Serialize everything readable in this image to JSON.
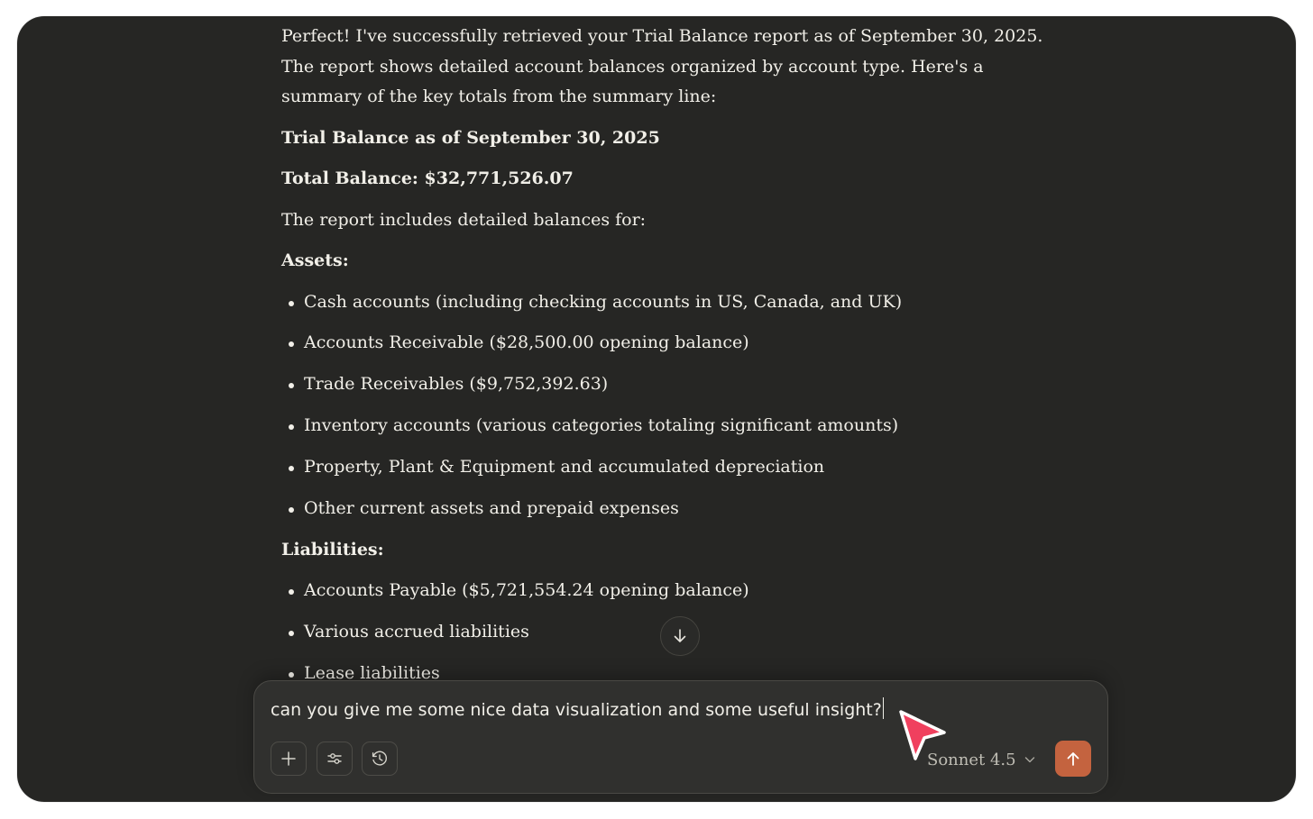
{
  "message": {
    "intro": "Perfect! I've successfully retrieved your Trial Balance report as of September 30, 2025. The report shows detailed account balances organized by account type. Here's a summary of the key totals from the summary line:",
    "heading": "Trial Balance as of September 30, 2025",
    "total": "Total Balance: $32,771,526.07",
    "includes": "The report includes detailed balances for:",
    "assets_heading": "Assets:",
    "assets": [
      "Cash accounts (including checking accounts in US, Canada, and UK)",
      "Accounts Receivable ($28,500.00 opening balance)",
      "Trade Receivables ($9,752,392.63)",
      "Inventory accounts (various categories totaling significant amounts)",
      "Property, Plant & Equipment and accumulated depreciation",
      "Other current assets and prepaid expenses"
    ],
    "liabilities_heading": "Liabilities:",
    "liabilities": [
      "Accounts Payable ($5,721,554.24 opening balance)",
      "Various accrued liabilities",
      "Lease liabilities"
    ]
  },
  "composer": {
    "input_value": "can you give me some nice data visualization and some useful insight?",
    "model_label": "Sonnet 4.5",
    "icons": {
      "add": "plus-icon",
      "tools": "sliders-icon",
      "history": "clock-icon",
      "model_menu": "chevron-down-icon",
      "send": "arrow-up-icon"
    }
  },
  "scroll_icon": "arrow-down-icon",
  "colors": {
    "background": "#262624",
    "text": "#f1efe8",
    "accent": "#c4633f",
    "cursor": "#f0405e"
  }
}
